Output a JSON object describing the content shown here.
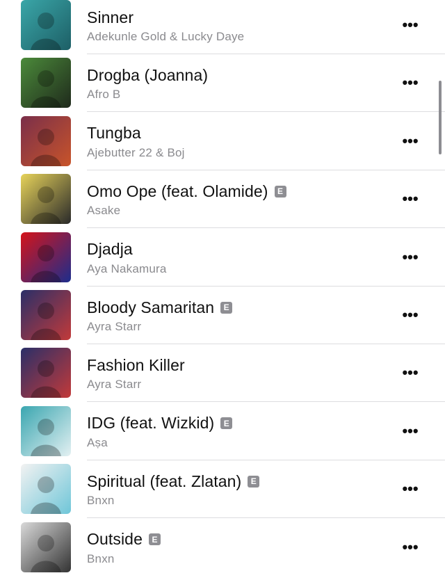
{
  "songs": [
    {
      "title": "Sinner",
      "artist": "Adekunle Gold & Lucky Daye",
      "explicit": false,
      "art_colors": [
        "#3aa6a8",
        "#1d5f66"
      ]
    },
    {
      "title": "Drogba (Joanna)",
      "artist": "Afro B",
      "explicit": false,
      "art_colors": [
        "#4b8a3a",
        "#1f2a1c"
      ]
    },
    {
      "title": "Tungba",
      "artist": "Ajebutter 22 & Boj",
      "explicit": false,
      "art_colors": [
        "#7a2f4a",
        "#c8542a"
      ]
    },
    {
      "title": "Omo Ope (feat. Olamide)",
      "artist": "Asake",
      "explicit": true,
      "art_colors": [
        "#e7d35a",
        "#2a2a2a"
      ]
    },
    {
      "title": "Djadja",
      "artist": "Aya Nakamura",
      "explicit": false,
      "art_colors": [
        "#d4141a",
        "#1d2d8c"
      ]
    },
    {
      "title": "Bloody Samaritan",
      "artist": "Ayra Starr",
      "explicit": true,
      "art_colors": [
        "#2a2f68",
        "#c23a3a"
      ]
    },
    {
      "title": "Fashion Killer",
      "artist": "Ayra Starr",
      "explicit": false,
      "art_colors": [
        "#2a2f68",
        "#c23a3a"
      ]
    },
    {
      "title": "IDG (feat. Wizkid)",
      "artist": "Aṣa",
      "explicit": true,
      "art_colors": [
        "#3aa6b0",
        "#e3f0f2"
      ]
    },
    {
      "title": "Spiritual (feat. Zlatan)",
      "artist": "Bnxn",
      "explicit": true,
      "art_colors": [
        "#f2f2f2",
        "#6fc6d8"
      ]
    },
    {
      "title": "Outside",
      "artist": "Bnxn",
      "explicit": true,
      "art_colors": [
        "#d9d9d9",
        "#333333"
      ]
    }
  ],
  "explicit_badge": "E",
  "more_button_label": "•••"
}
